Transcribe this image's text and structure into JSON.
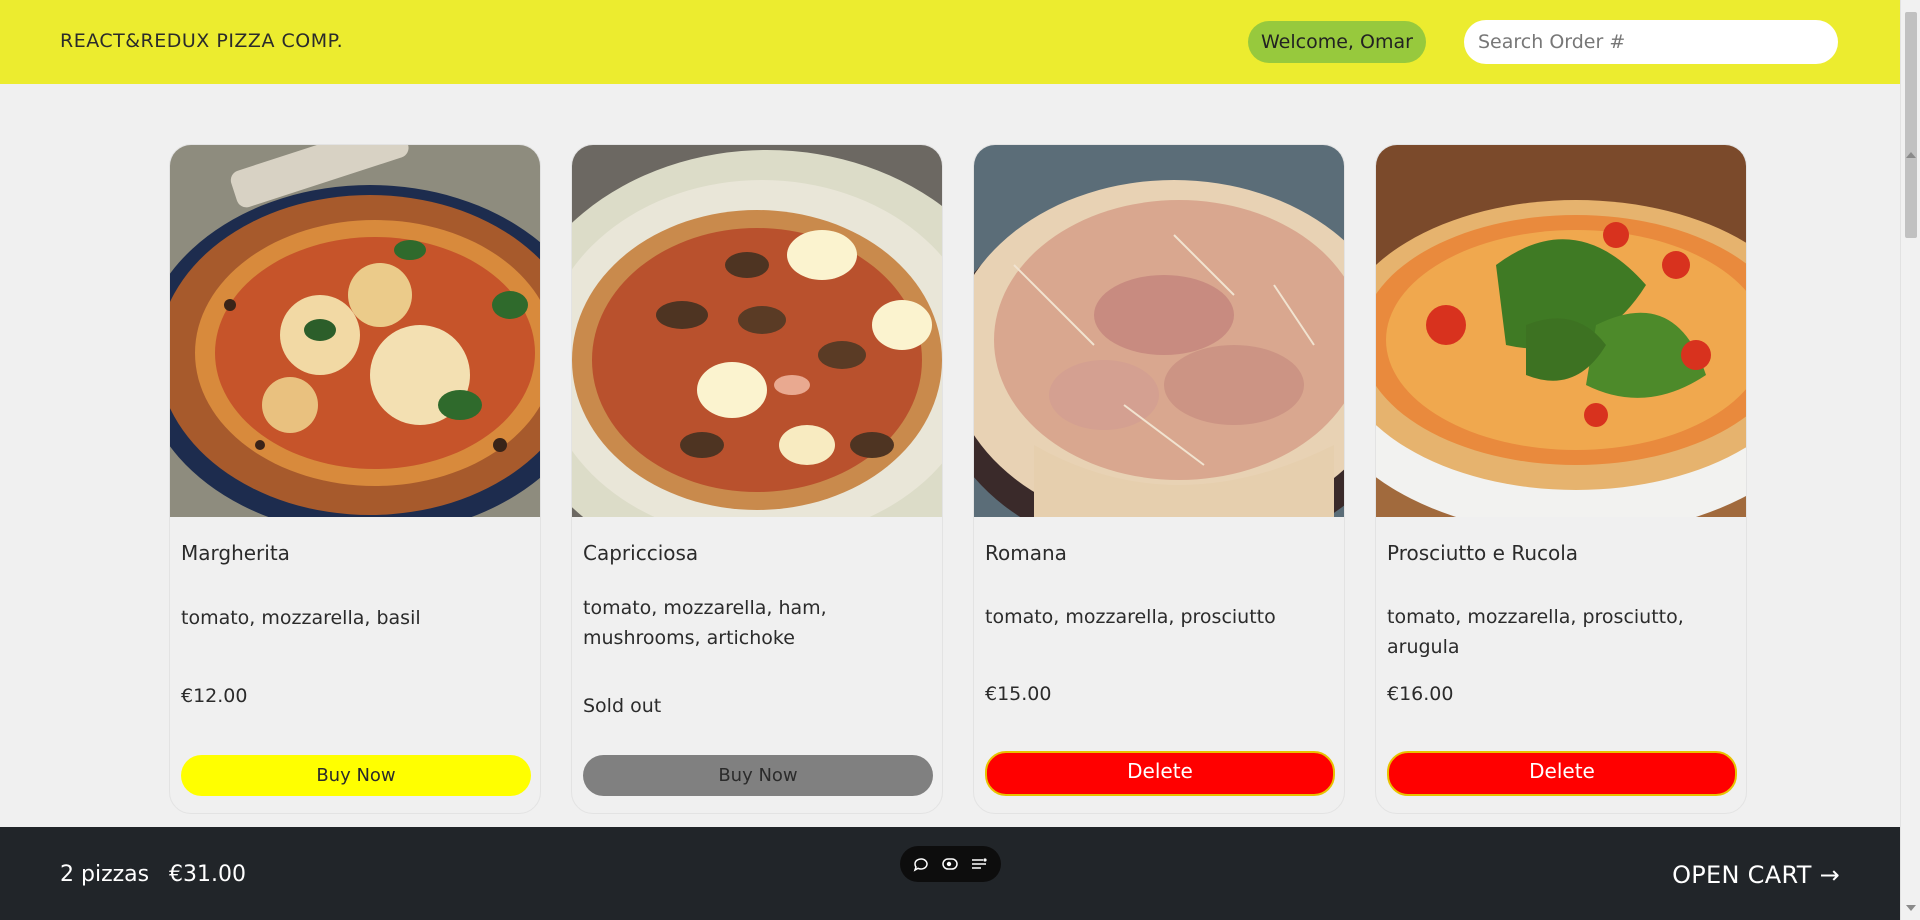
{
  "header": {
    "brand": "REACT&REDUX PIZZA COMP.",
    "welcome": "Welcome, Omar",
    "search_placeholder": "Search Order #"
  },
  "pizzas": [
    {
      "name": "Margherita",
      "ingredients": "tomato, mozzarella, basil",
      "price": "€12.00",
      "action": "Buy Now",
      "status": "available"
    },
    {
      "name": "Capricciosa",
      "ingredients": "tomato, mozzarella, ham, mushrooms, artichoke",
      "price": "Sold out",
      "action": "Buy Now",
      "status": "sold-out"
    },
    {
      "name": "Romana",
      "ingredients": "tomato, mozzarella, prosciutto",
      "price": "€15.00",
      "action": "Delete",
      "status": "in-cart"
    },
    {
      "name": "Prosciutto e Rucola",
      "ingredients": "tomato, mozzarella, prosciutto, arugula",
      "price": "€16.00",
      "action": "Delete",
      "status": "in-cart"
    }
  ],
  "cart": {
    "count": "2 pizzas",
    "total": "€31.00",
    "open_label": "OPEN CART →"
  },
  "toolbar_icons": [
    "chat-icon",
    "eye-icon",
    "menu-lines-icon"
  ],
  "colors": {
    "header_bg": "#ecec2f",
    "welcome_bg": "#97c93d",
    "buy_button": "#ffff00",
    "sold_out_button": "#808080",
    "delete_button": "#ff0000",
    "footer_bg": "#212529"
  }
}
